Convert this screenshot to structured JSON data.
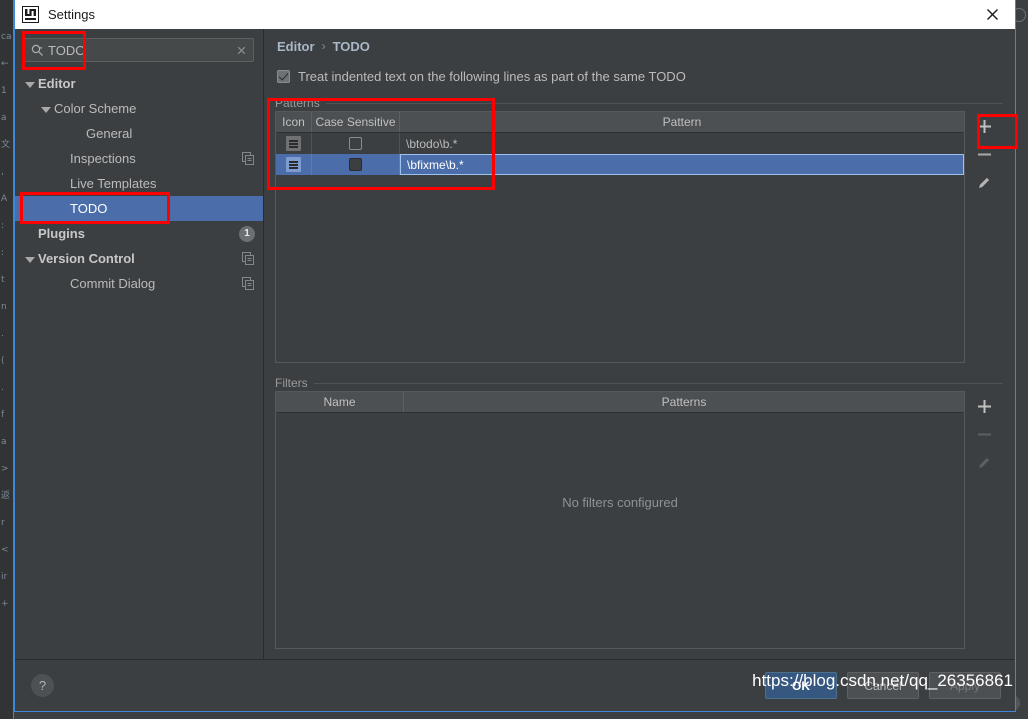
{
  "window": {
    "title": "Settings",
    "logo_icon": "intellij-idea-logo-icon",
    "close_icon": "close-icon"
  },
  "sidebar": {
    "search": {
      "value": "TODO",
      "placeholder": "",
      "search_icon": "search-icon",
      "clear_icon": "clear-icon"
    },
    "items": [
      {
        "label": "Editor",
        "indent": 0,
        "arrow": true,
        "bold": true,
        "selected": false,
        "right": ""
      },
      {
        "label": "Color Scheme",
        "indent": 1,
        "arrow": true,
        "bold": false,
        "selected": false,
        "right": ""
      },
      {
        "label": "General",
        "indent": 3,
        "arrow": false,
        "bold": false,
        "selected": false,
        "right": ""
      },
      {
        "label": "Inspections",
        "indent": 2,
        "arrow": false,
        "bold": false,
        "selected": false,
        "right": "copy-icon"
      },
      {
        "label": "Live Templates",
        "indent": 2,
        "arrow": false,
        "bold": false,
        "selected": false,
        "right": ""
      },
      {
        "label": "TODO",
        "indent": 2,
        "arrow": false,
        "bold": false,
        "selected": true,
        "right": ""
      },
      {
        "label": "Plugins",
        "indent": 0,
        "arrow": false,
        "bold": true,
        "selected": false,
        "right": "badge",
        "badge": "1"
      },
      {
        "label": "Version Control",
        "indent": 0,
        "arrow": true,
        "bold": true,
        "selected": false,
        "right": "copy-icon"
      },
      {
        "label": "Commit Dialog",
        "indent": 2,
        "arrow": false,
        "bold": false,
        "selected": false,
        "right": "copy-icon"
      }
    ]
  },
  "main": {
    "breadcrumb": {
      "parent": "Editor",
      "separator": "›",
      "current": "TODO"
    },
    "indent_checkbox": {
      "label": "Treat indented text on the following lines as part of the same TODO",
      "checked": true
    },
    "patterns": {
      "group_title": "Patterns",
      "columns": [
        "Icon",
        "Case Sensitive",
        "Pattern"
      ],
      "rows": [
        {
          "icon": "todo-pattern-icon",
          "case_sensitive": false,
          "pattern": "\\btodo\\b.*",
          "selected": false
        },
        {
          "icon": "todo-pattern-icon",
          "case_sensitive": true,
          "pattern": "\\bfixme\\b.*",
          "selected": true
        }
      ],
      "toolbar": [
        {
          "name": "add-pattern-button",
          "icon": "plus-icon",
          "enabled": true
        },
        {
          "name": "remove-pattern-button",
          "icon": "minus-icon",
          "enabled": true
        },
        {
          "name": "edit-pattern-button",
          "icon": "pencil-icon",
          "enabled": true
        }
      ]
    },
    "filters": {
      "group_title": "Filters",
      "columns": [
        "Name",
        "Patterns"
      ],
      "rows": [],
      "empty_message": "No filters configured",
      "toolbar": [
        {
          "name": "add-filter-button",
          "icon": "plus-icon",
          "enabled": true
        },
        {
          "name": "remove-filter-button",
          "icon": "minus-icon",
          "enabled": false
        },
        {
          "name": "edit-filter-button",
          "icon": "pencil-icon",
          "enabled": false
        }
      ]
    }
  },
  "footer": {
    "help_label": "?",
    "ok_label": "OK",
    "cancel_label": "Cancel",
    "apply_label": "Apply"
  },
  "watermark": "https://blog.csdn.net/qq_26356861",
  "colors": {
    "accent_selection": "#4b6eab",
    "primary_button": "#365880",
    "annotation": "#ff0000",
    "window_bg": "#3c3f41"
  },
  "background_editor": {
    "gutter_chars": [
      "ca",
      "←",
      "1",
      "a",
      "文",
      ",",
      "A",
      ":",
      ":",
      "t",
      "n",
      ".",
      "(",
      ".",
      "f",
      "a",
      ">",
      "返",
      "r",
      "<",
      "ir",
      "+"
    ]
  }
}
